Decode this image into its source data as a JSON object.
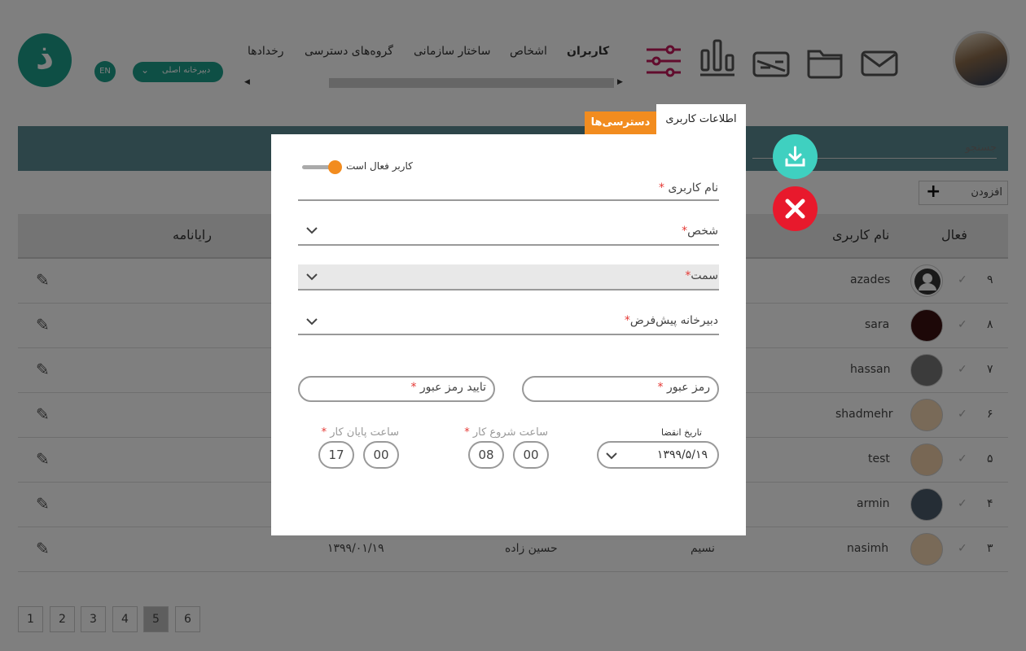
{
  "header": {
    "nav": [
      "کاربران",
      "اشخاص",
      "ساختار سازمانی",
      "گروه‌های دسترسی",
      "رخدادها"
    ],
    "secretariat_label": "دبیرخانه اصلی",
    "lang_label": "EN",
    "logo_letter": "ذ"
  },
  "search": {
    "placeholder": "جستجو"
  },
  "add_button": {
    "label": "افزودن"
  },
  "table": {
    "headers": {
      "active": "فعال",
      "username": "نام کاربری",
      "email": "رایانامه"
    },
    "rows": [
      {
        "index": "۹",
        "username": "azades"
      },
      {
        "index": "۸",
        "username": "sara"
      },
      {
        "index": "۷",
        "username": "hassan"
      },
      {
        "index": "۶",
        "username": "shadmehr"
      },
      {
        "index": "۵",
        "username": "test"
      },
      {
        "index": "۴",
        "username": "armin"
      },
      {
        "index": "۳",
        "username": "nasimh",
        "firstname": "نسیم",
        "lastname": "حسین زاده",
        "date": "۱۳۹۹/۰۱/۱۹"
      }
    ]
  },
  "pagination": [
    "1",
    "2",
    "3",
    "4",
    "5",
    "6"
  ],
  "pagination_active": "5",
  "modal": {
    "tabs": {
      "user_info": "اطلاعات کاربری",
      "permissions": "دسترسی‌ها"
    },
    "active_toggle_label": "کاربر فعال است",
    "username_label": "نام کاربری",
    "person_label": "شخص",
    "position_label": "سمت",
    "default_secretariat_label": "دبیرخانه پیش‌فرض",
    "password_label": "رمز عبور",
    "confirm_password_label": "تایید رمز عبور",
    "expiry_label": "تاریخ انقضا",
    "expiry_value": "۱۳۹۹/۵/۱۹",
    "work_start_label": "ساعت شروع کار",
    "work_start_hour": "08",
    "work_start_min": "00",
    "work_end_label": "ساعت پایان کار",
    "work_end_hour": "17",
    "work_end_min": "00",
    "required_mark": "*"
  },
  "colors": {
    "teal": "#1d9e8a",
    "orange": "#f28c1f",
    "save": "#3fd0c0",
    "cancel": "#e8192c"
  }
}
